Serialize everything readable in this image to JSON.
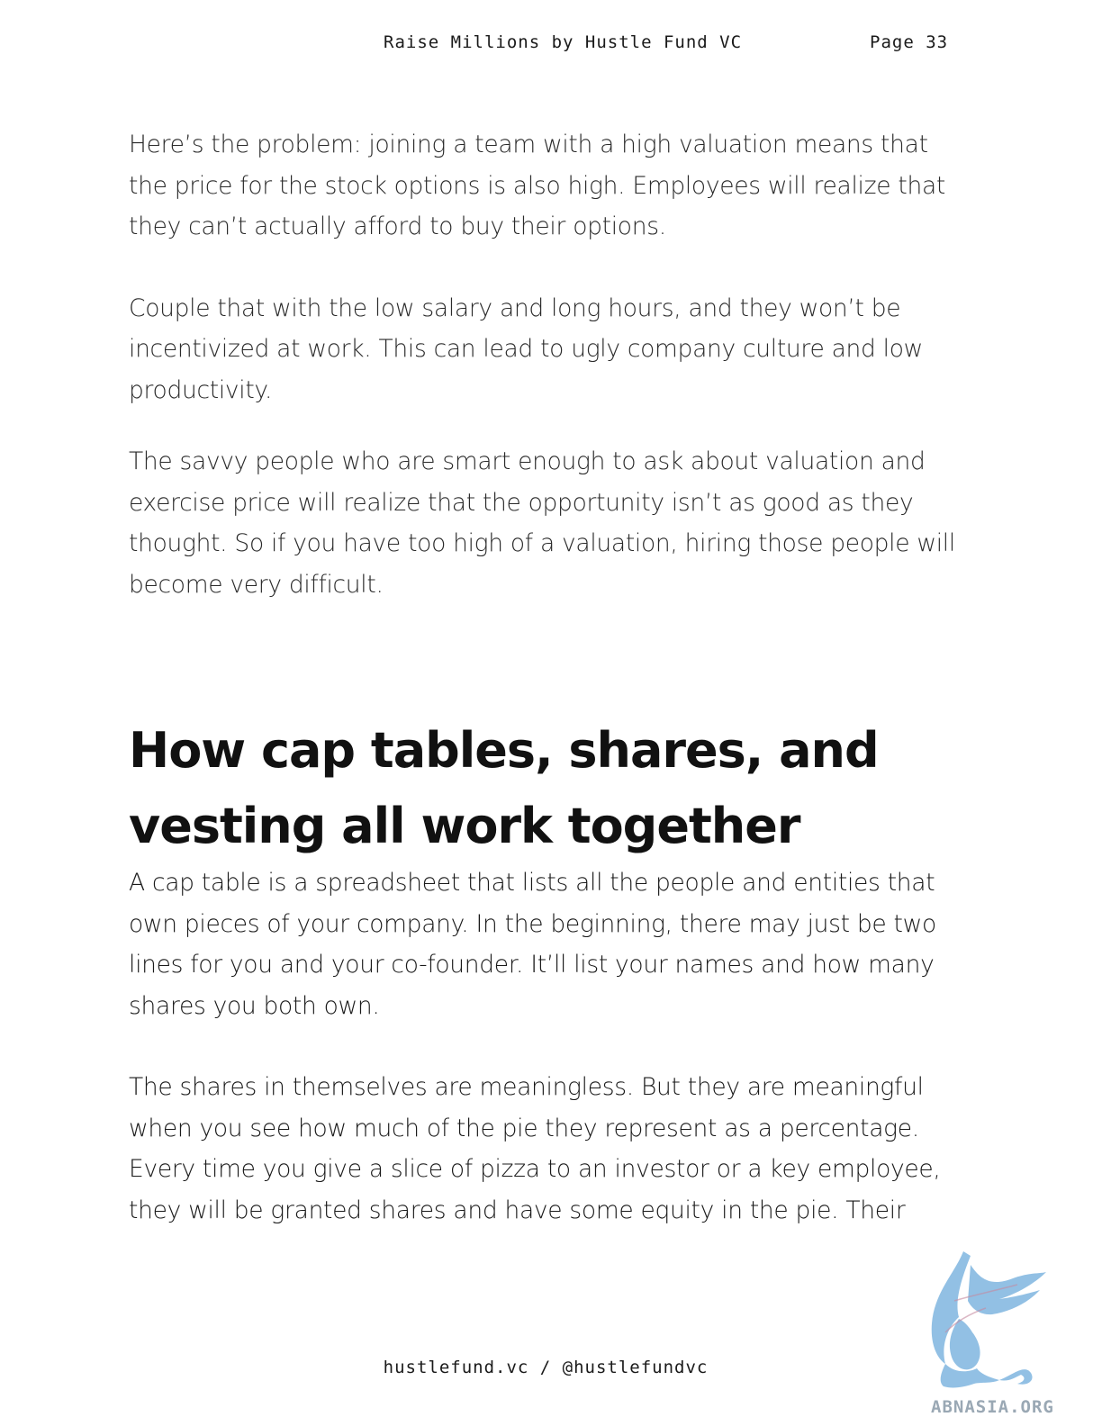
{
  "header": {
    "title": "Raise Millions by Hustle Fund VC",
    "page": "Page 33"
  },
  "paragraphs": {
    "p1": "Here’s the problem: joining a team with a high valuation means that the price for the stock options is also high. Employees will realize that they can’t actually afford to buy their options.",
    "p2": "Couple that with the low salary and long hours, and they won’t be incentivized at work. This can lead to ugly company culture and low productivity.",
    "p3": "The savvy people who are smart enough to ask about valuation and exercise price will realize that the opportunity isn’t as good as they thought. So if you have too high of a valuation, hiring those people will become very difficult.",
    "heading": "How cap tables, shares, and vesting all work together",
    "p4": "A cap table is a spreadsheet that lists all the people and entities that own pieces of your company. In the beginning, there may just be two lines for you and your co-founder. It’ll list your names and how many shares you both own.",
    "p5": "The shares in themselves are meaningless. But they are meaningful when you see how much of the pie they represent as a percentage. Every time you give a slice of pizza to an investor or a key employee, they will be granted shares and have some equity in the pie. Their"
  },
  "footer": {
    "text": "hustlefund.vc / @hustlefundvc"
  },
  "watermark": {
    "text": "ABNASIA.ORG",
    "icon": "griffin-logo-icon",
    "color": "#7fb6e0"
  }
}
